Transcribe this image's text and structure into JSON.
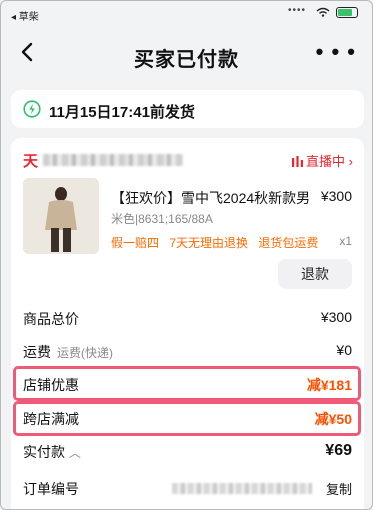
{
  "status_bar": {
    "back_app": "◂ 草柴"
  },
  "nav": {
    "title": "买家已付款"
  },
  "shipping": {
    "text": "11月15日17:41前发货"
  },
  "shop": {
    "logo": "天",
    "live_label": "直播中"
  },
  "product": {
    "name": "【狂欢价】雪中飞2024秋新款男",
    "price": "¥300",
    "spec": "米色|8631;165/88A",
    "tags": [
      "假一赔四",
      "7天无理由退换",
      "退货包运费"
    ],
    "qty": "x1",
    "refund_label": "退款"
  },
  "summary": {
    "goods_total_label": "商品总价",
    "goods_total_value": "¥300",
    "shipping_label": "运费",
    "shipping_sub": "运费(快递)",
    "shipping_value": "¥0",
    "store_discount_label": "店铺优惠",
    "store_discount_value": "减¥181",
    "cross_store_label": "跨店满减",
    "cross_store_value": "减¥50",
    "paid_label": "实付款",
    "paid_value": "¥69",
    "order_no_label": "订单编号",
    "copy_label": "复制"
  },
  "colors": {
    "brand_red": "#e8262e",
    "accent_orange": "#ff5000",
    "highlight_pink": "#ef5a78"
  }
}
